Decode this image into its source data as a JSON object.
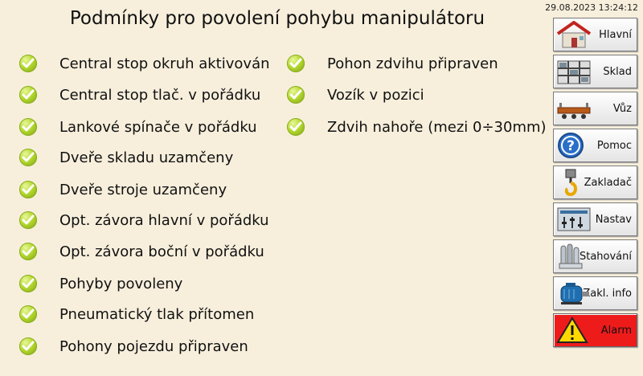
{
  "title": "Podmínky pro povolení pohybu manipulátoru",
  "datetime": "29.08.2023 13:24:12",
  "conditions_left": [
    "Central stop okruh aktivován",
    "Central stop tlač. v pořádku",
    "Lankové spínače v pořádku",
    "Dveře skladu uzamčeny",
    "Dveře stroje uzamčeny",
    "Opt. závora hlavní v pořádku",
    "Opt. závora boční v pořádku",
    "Pohyby povoleny",
    "Pneumatický tlak přítomen",
    "Pohony pojezdu připraven"
  ],
  "conditions_right": [
    "Pohon zdvihu připraven",
    "Vozík v pozici",
    "Zdvih nahoře (mezi 0÷30mm)"
  ],
  "nav": {
    "main": "Hlavní",
    "warehouse": "Sklad",
    "cart": "Vůz",
    "help": "Pomoc",
    "loader": "Zakladač",
    "settings": "Nastav",
    "download": "Stahování",
    "info": "Zakl. info",
    "alarm": "Alarm"
  },
  "colors": {
    "background": "#f7efdc",
    "check": "#b4d82e",
    "alarm": "#ee1b1b"
  }
}
